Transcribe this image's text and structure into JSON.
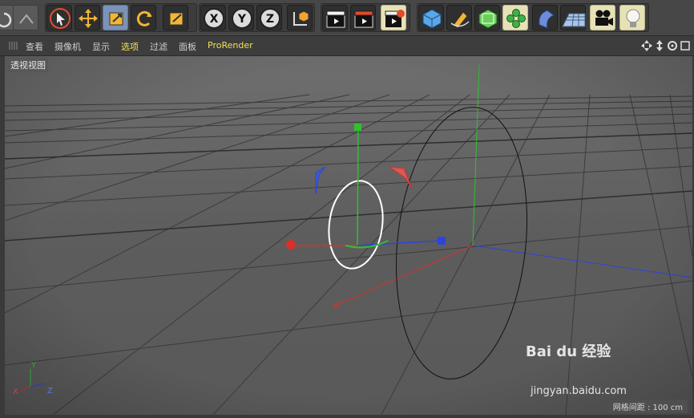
{
  "menubar": {
    "items": [
      "查看",
      "摄像机",
      "显示",
      "选项",
      "过滤",
      "面板",
      "ProRender"
    ],
    "active": "选项"
  },
  "viewport": {
    "label": "透视视图",
    "grid_info": "网格间距 : 100 cm",
    "axes": {
      "x": "X",
      "y": "Y",
      "z": "Z"
    }
  },
  "toolbar": {
    "axis_buttons": [
      "X",
      "Y",
      "Z"
    ]
  },
  "watermark": {
    "brand": "Bai du 经验",
    "url": "jingyan.baidu.com"
  },
  "colors": {
    "accent_x": "#d9302a",
    "accent_y": "#2fc12f",
    "accent_z": "#2c45d8",
    "active_menu": "#f2e15a"
  }
}
